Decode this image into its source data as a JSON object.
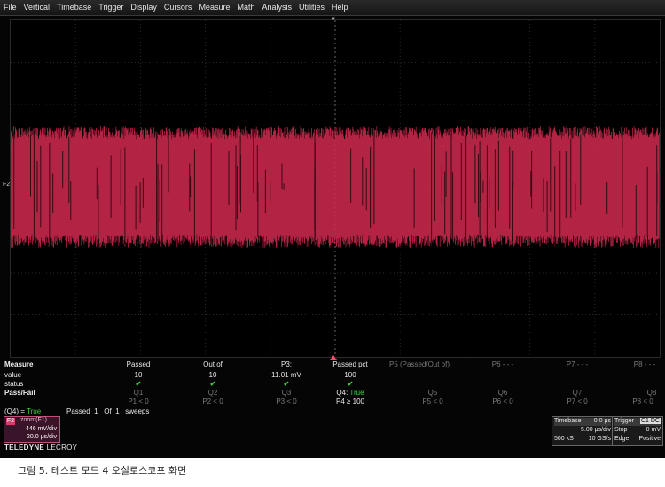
{
  "menu": [
    "File",
    "Vertical",
    "Timebase",
    "Trigger",
    "Display",
    "Cursors",
    "Measure",
    "Math",
    "Analysis",
    "Utilities",
    "Help"
  ],
  "trace": {
    "marker": "F2",
    "color": "#d22a50",
    "amplitude_divs": 2.9
  },
  "measure_table": {
    "headers": {
      "label": "Measure",
      "cols": [
        "Passed",
        "Out of",
        "P3:",
        "Passed pct",
        "P5 (Passed/Out of)",
        "P6 - - -",
        "P7 - - -",
        "P8 - - -"
      ]
    },
    "value_row": {
      "label": "value",
      "cols": [
        "10",
        "10",
        "11.01 mV",
        "100",
        "",
        "",
        "",
        ""
      ]
    },
    "status_row": {
      "label": "status",
      "check": "✔"
    },
    "passfail_row": {
      "label": "Pass/Fail",
      "q_names": [
        "Q1",
        "Q2",
        "Q3",
        "Q4:",
        "Q5",
        "Q6",
        "Q7",
        "Q8"
      ],
      "q4_value": "True",
      "conditions": [
        "P1 < 0",
        "P2 < 0",
        "P3 < 0",
        "P4 ≥ 100",
        "P5 < 0",
        "P6 < 0",
        "P7 < 0",
        "P8 < 0"
      ]
    }
  },
  "status_line": {
    "q4_label": "(Q4) =",
    "q4_value": "True",
    "sweeps": "Passed  1   Of  1   sweeps"
  },
  "channel": {
    "tag": "F2",
    "name": "zoom(F1)",
    "vdiv": "446 mV/div",
    "tdiv": "20.0 μs/div"
  },
  "logo": {
    "brand": "TELEDYNE",
    "sub": "LECROY"
  },
  "timebase": {
    "title": "Timebase",
    "delay": "0.0 μs",
    "tdiv": "5.00 μs/div",
    "samples": "500 kS",
    "rate": "10 GS/s"
  },
  "trigger": {
    "title": "Trigger",
    "tag": "C1 DC",
    "mode": "Stop",
    "level": "0 mV",
    "type": "Edge",
    "slope": "Positive"
  },
  "caption": "그림 5. 테스트 모드 4 오실로스코프 화면"
}
